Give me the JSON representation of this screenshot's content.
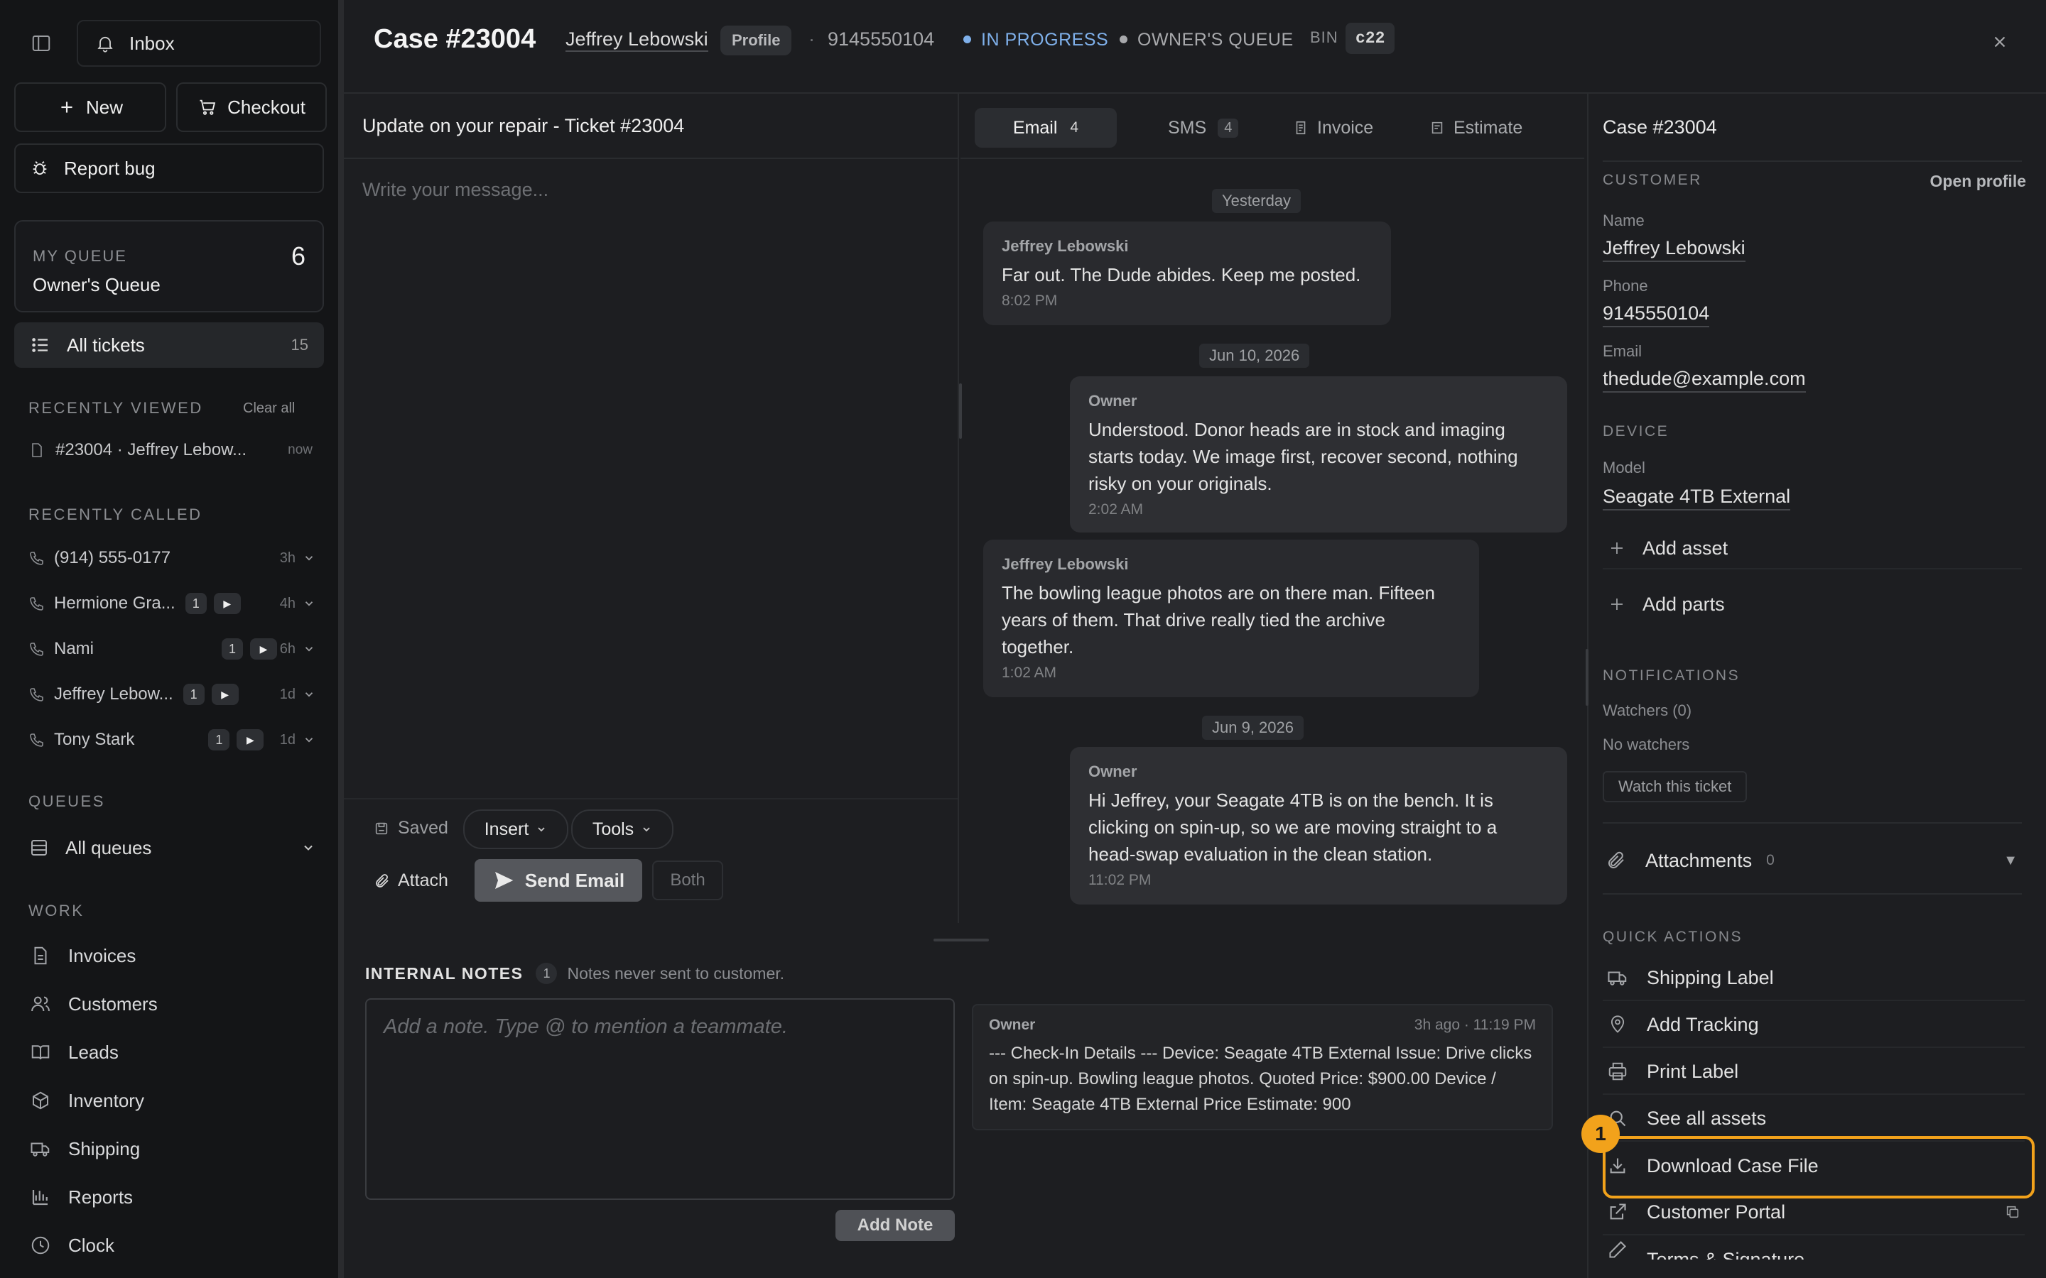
{
  "sidebar": {
    "inbox_label": "Inbox",
    "new_label": "New",
    "checkout_label": "Checkout",
    "report_bug_label": "Report bug",
    "my_queue": {
      "caption": "MY QUEUE",
      "name": "Owner's Queue",
      "count": "6"
    },
    "all_tickets": {
      "label": "All tickets",
      "count": "15"
    },
    "recently_viewed": {
      "heading": "RECENTLY VIEWED",
      "clear_label": "Clear all",
      "items": [
        {
          "label": "#23004 · Jeffrey Lebow...",
          "time": "now"
        }
      ]
    },
    "recently_called": {
      "heading": "RECENTLY CALLED",
      "items": [
        {
          "name": "(914) 555-0177",
          "badge": "",
          "time": "3h"
        },
        {
          "name": "Hermione Gra...",
          "badge": "1",
          "time": "4h"
        },
        {
          "name": "Nami",
          "badge": "1",
          "time": "6h"
        },
        {
          "name": "Jeffrey Lebow...",
          "badge": "1",
          "time": "1d"
        },
        {
          "name": "Tony Stark",
          "badge": "1",
          "time": "1d"
        }
      ]
    },
    "queues": {
      "heading": "QUEUES",
      "all_label": "All queues"
    },
    "work": {
      "heading": "WORK",
      "items": [
        {
          "label": "Invoices",
          "icon": "file-icon"
        },
        {
          "label": "Customers",
          "icon": "users-icon"
        },
        {
          "label": "Leads",
          "icon": "book-icon"
        },
        {
          "label": "Inventory",
          "icon": "box-icon"
        },
        {
          "label": "Shipping",
          "icon": "truck-icon"
        },
        {
          "label": "Reports",
          "icon": "bar-chart-icon"
        },
        {
          "label": "Clock",
          "icon": "clock-icon"
        }
      ]
    }
  },
  "header": {
    "case_title": "Case #23004",
    "customer_name": "Jeffrey Lebowski",
    "profile_label": "Profile",
    "phone": "9145550104",
    "status": "IN PROGRESS",
    "queue": "OWNER'S QUEUE",
    "bin_label": "BIN",
    "bin_value": "c22"
  },
  "compose": {
    "subject": "Update on your repair - Ticket #23004",
    "placeholder": "Write your message...",
    "saved_label": "Saved",
    "insert_label": "Insert",
    "tools_label": "Tools",
    "attach_label": "Attach",
    "send_label": "Send Email",
    "both_label": "Both"
  },
  "thread": {
    "tabs": [
      {
        "label": "Email",
        "count": "4"
      },
      {
        "label": "SMS",
        "count": "4"
      },
      {
        "label": "Invoice"
      },
      {
        "label": "Estimate"
      }
    ],
    "dates": [
      "Yesterday",
      "Jun 10, 2026",
      "Jun 9, 2026"
    ],
    "messages": [
      {
        "from": "Jeffrey Lebowski",
        "body": "Far out. The Dude abides. Keep me posted.",
        "time": "8:02 PM"
      },
      {
        "from": "Owner",
        "body": "Understood. Donor heads are in stock and imaging starts today. We image first, recover second, nothing risky on your originals.",
        "time": "2:02 AM"
      },
      {
        "from": "Jeffrey Lebowski",
        "body": "The bowling league photos are on there man. Fifteen years of them. That drive really tied the archive together.",
        "time": "1:02 AM"
      },
      {
        "from": "Owner",
        "body": "Hi Jeffrey, your Seagate 4TB is on the bench. It is clicking on spin-up, so we are moving straight to a head-swap evaluation in the clean station.",
        "time": "11:02 PM"
      }
    ]
  },
  "notes": {
    "heading": "INTERNAL NOTES",
    "count": "1",
    "subtitle": "Notes never sent to customer.",
    "placeholder": "Add a note. Type @ to mention a teammate.",
    "add_label": "Add Note",
    "entries": [
      {
        "author": "Owner",
        "time": "3h ago · 11:19 PM",
        "body": "--- Check-In Details --- Device: Seagate 4TB External Issue: Drive clicks on spin-up. Bowling league photos. Quoted Price: $900.00 Device / Item: Seagate 4TB External Price Estimate: 900"
      }
    ]
  },
  "panel": {
    "title": "Case #23004",
    "customer_heading": "CUSTOMER",
    "open_profile": "Open profile",
    "name_label": "Name",
    "name_value": "Jeffrey Lebowski",
    "phone_label": "Phone",
    "phone_value": "9145550104",
    "email_label": "Email",
    "email_value": "thedude@example.com",
    "device_heading": "DEVICE",
    "model_label": "Model",
    "model_value": "Seagate 4TB External",
    "add_asset": "Add asset",
    "add_parts": "Add parts",
    "notifications_heading": "NOTIFICATIONS",
    "watchers": "Watchers (0)",
    "no_watchers": "No watchers",
    "watch_btn": "Watch this ticket",
    "attachments_label": "Attachments",
    "attachments_count": "0",
    "quick_actions_heading": "QUICK ACTIONS",
    "quick_actions": [
      "Shipping Label",
      "Add Tracking",
      "Print Label",
      "See all assets",
      "Download Case File",
      "Customer Portal",
      "Terms & Signature"
    ],
    "highlight_marker": "1"
  },
  "colors": {
    "accent_status": "#7fb0ea",
    "highlight": "#f2a21b",
    "background": "#1d1e21"
  }
}
